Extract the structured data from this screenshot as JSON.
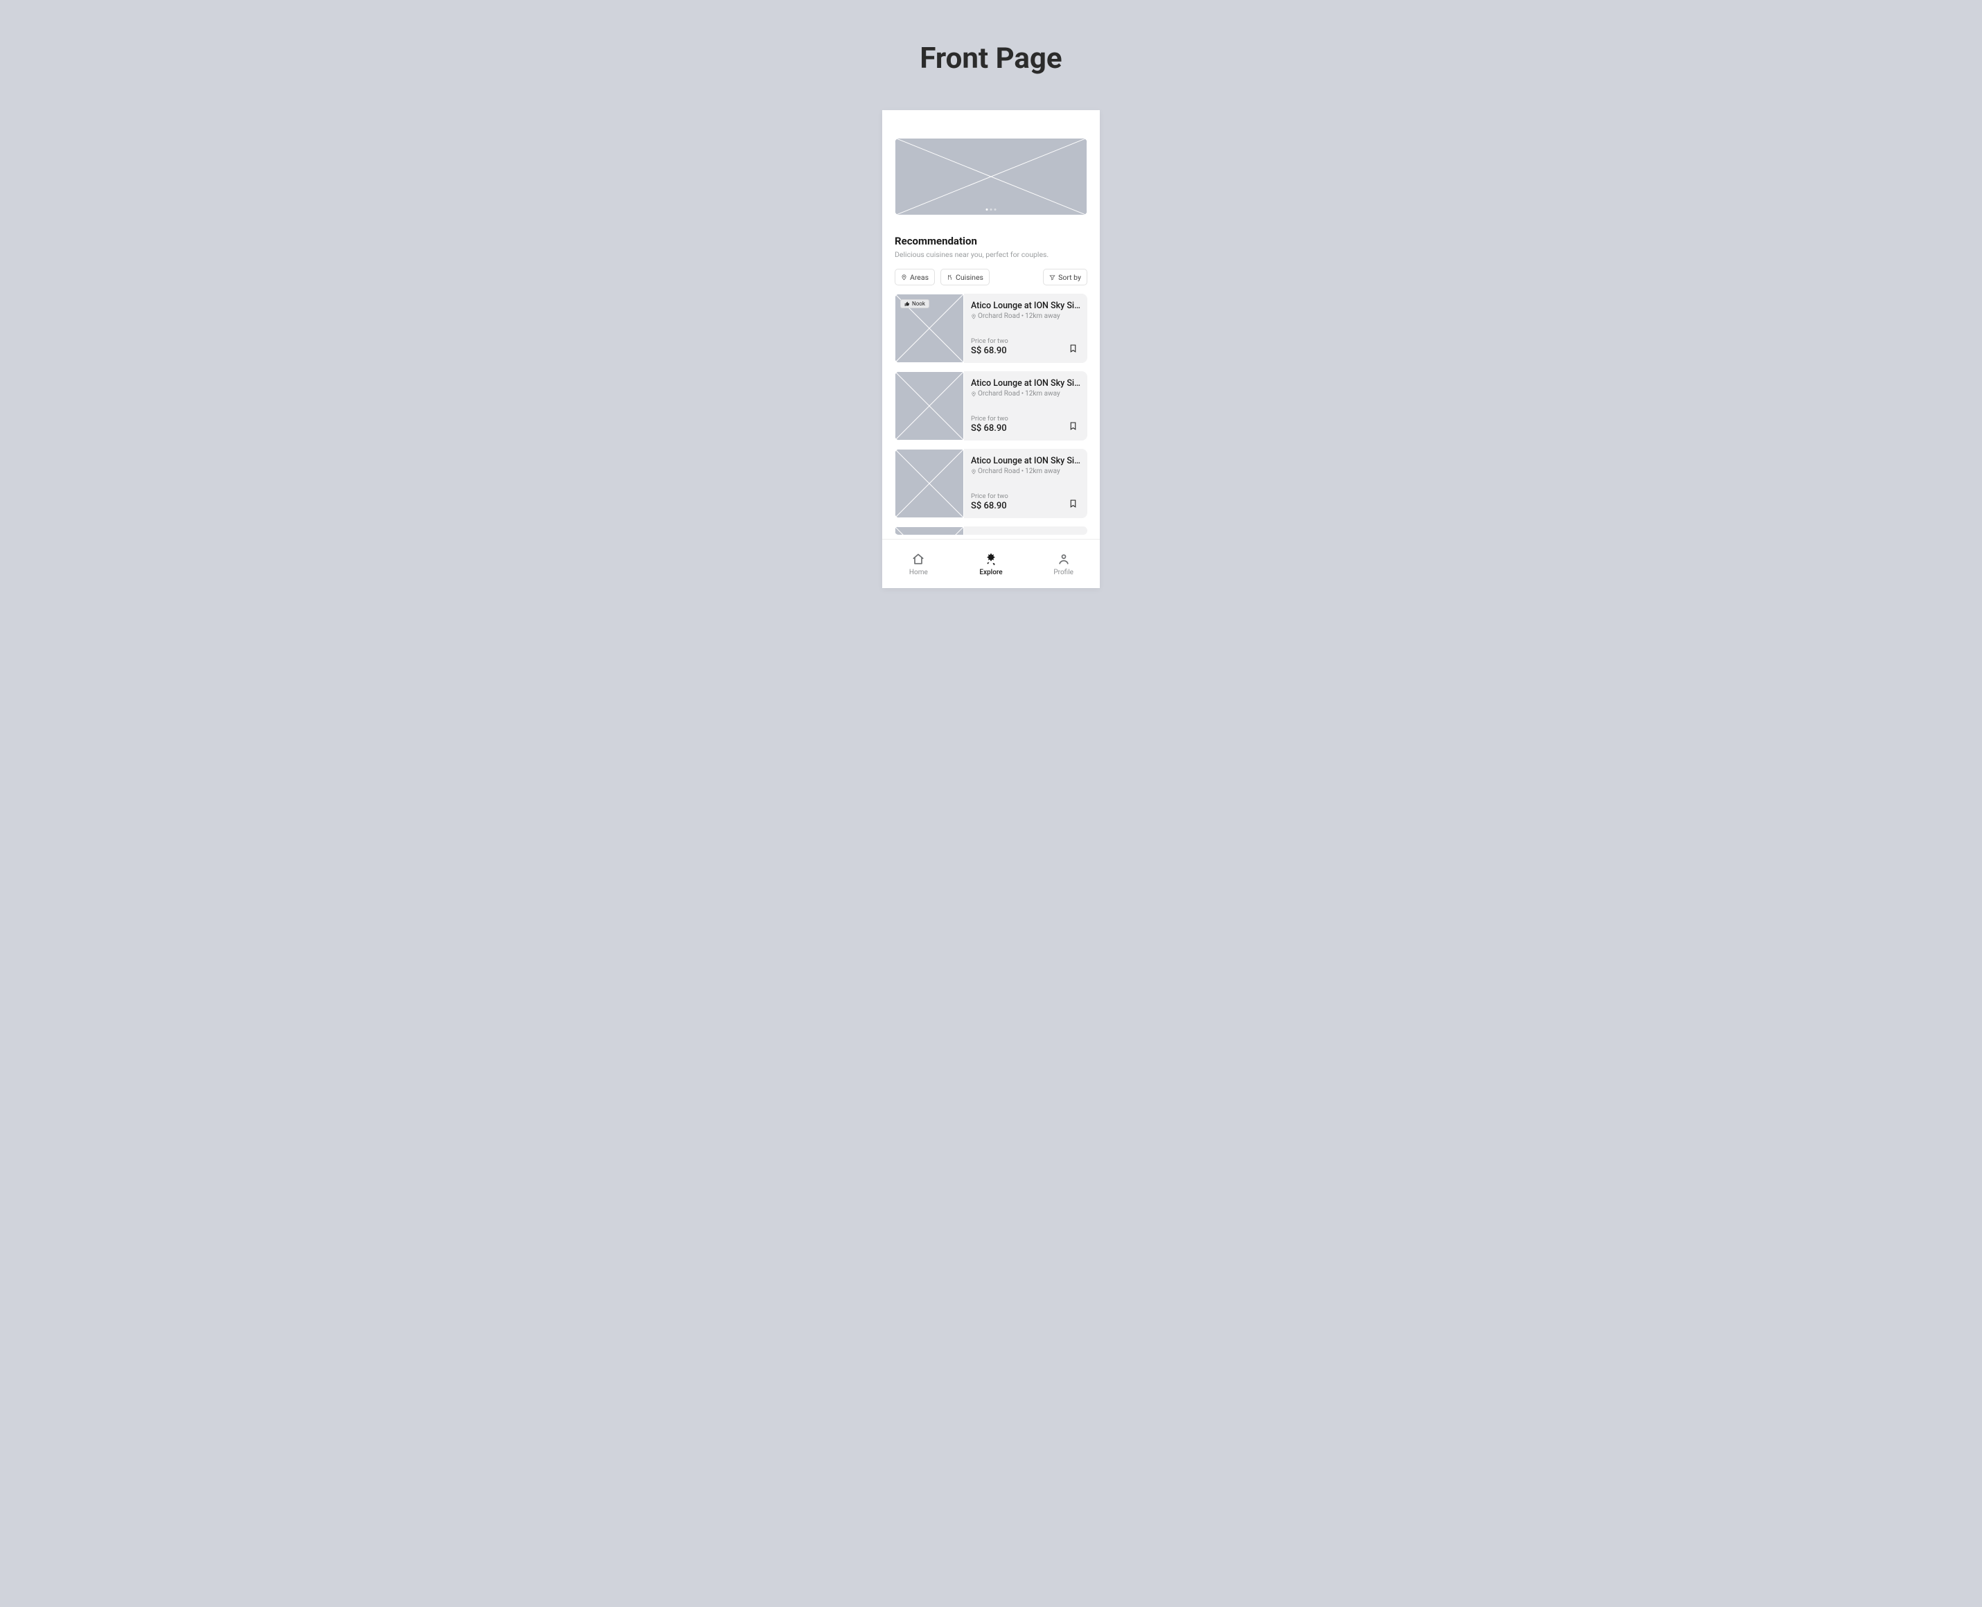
{
  "page_title": "Front Page",
  "section": {
    "title": "Recommendation",
    "subtitle": "Delicious cuisines near you, perfect for couples."
  },
  "filters": {
    "areas": "Areas",
    "cuisines": "Cuisines",
    "sort": "Sort by"
  },
  "cards": [
    {
      "badge": "Nook",
      "title": "Atico Lounge at ION Sky Si…",
      "location": "Orchard Road",
      "distance": "12km away",
      "price_label": "Price for two",
      "price_value": "S$ 68.90"
    },
    {
      "title": "Atico Lounge at ION Sky Si…",
      "location": "Orchard Road",
      "distance": "12km away",
      "price_label": "Price for two",
      "price_value": "S$ 68.90"
    },
    {
      "title": "Atico Lounge at ION Sky Si…",
      "location": "Orchard Road",
      "distance": "12km away",
      "price_label": "Price for two",
      "price_value": "S$ 68.90"
    }
  ],
  "nav": {
    "home": "Home",
    "explore": "Explore",
    "profile": "Profile"
  }
}
